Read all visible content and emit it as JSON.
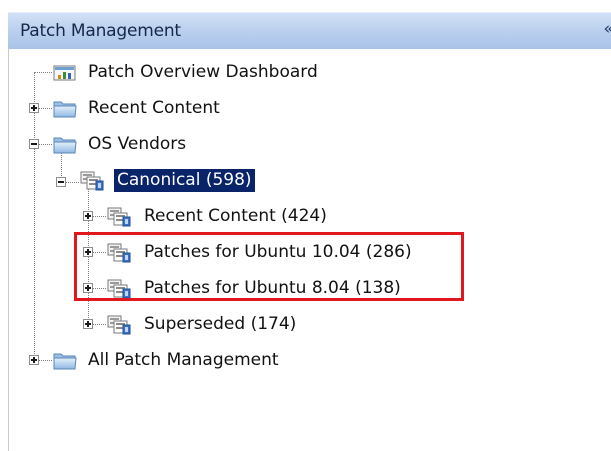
{
  "header": {
    "title": "Patch Management",
    "collapse_glyph": "«"
  },
  "tree": {
    "patch_overview": "Patch Overview Dashboard",
    "recent_content_root": "Recent Content",
    "os_vendors": "OS Vendors",
    "canonical": "Canonical (598)",
    "canonical_recent": "Recent Content (424)",
    "ubuntu_1004": "Patches for Ubuntu 10.04 (286)",
    "ubuntu_804": "Patches for Ubuntu 8.04 (138)",
    "superseded": "Superseded (174)",
    "all_patch_mgmt": "All Patch Management"
  },
  "icons": {
    "dashboard": "chart-dashboard-icon",
    "folder": "folder-icon",
    "group": "patch-group-icon"
  },
  "colors": {
    "header_gradient_top": "#d2e1f5",
    "header_gradient_bottom": "#a9c3e8",
    "selection": "#0a246a",
    "highlight_border": "#e2161d",
    "folder_blue": "#6e9fd3"
  }
}
